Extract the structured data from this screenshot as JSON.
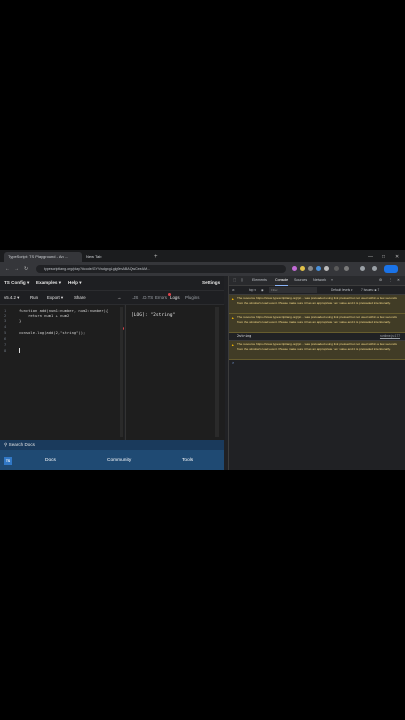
{
  "browser": {
    "tabs": [
      {
        "label": "TypeScript: TS Playground - An ..."
      },
      {
        "label": "New Tab"
      }
    ],
    "url": "typescriptlang.org/play?#code/GYVwdgxgLglg9mABAQwCeeAM...",
    "window_controls": [
      "—",
      "□",
      "✕"
    ]
  },
  "playground": {
    "menu": [
      {
        "label": "TS Config ▾"
      },
      {
        "label": "Examples ▾"
      },
      {
        "label": "Help ▾"
      },
      {
        "label": "Settings"
      }
    ],
    "toolbar": {
      "version": "v5.4.2 ▾",
      "run": "Run",
      "export": "Export ▾",
      "share": "Share",
      "arrow": "→"
    },
    "output_tabs": [
      {
        "label": ".JS"
      },
      {
        "label": ".D.TS"
      },
      {
        "label": "Errors"
      },
      {
        "label": "Logs"
      },
      {
        "label": "Plugins"
      }
    ],
    "code_lines": [
      {
        "n": "1",
        "text": "function add(num1:number, num2:number){"
      },
      {
        "n": "2",
        "text": "    return num1 + num2"
      },
      {
        "n": "3",
        "text": "}"
      },
      {
        "n": "4",
        "text": ""
      },
      {
        "n": "5",
        "text": "console.log(add(2,\"string\"));"
      },
      {
        "n": "6",
        "text": ""
      },
      {
        "n": "7",
        "text": ""
      },
      {
        "n": "8",
        "text": ""
      }
    ],
    "log_output": "[LOG]: \"2string\"",
    "search_docs": "Search Docs",
    "bottom_nav": [
      {
        "label": "Docs"
      },
      {
        "label": "Community"
      },
      {
        "label": "Tools"
      }
    ],
    "logo": "TS"
  },
  "devtools": {
    "tabs": [
      {
        "label": "Elements"
      },
      {
        "label": "Console"
      },
      {
        "label": "Sources"
      },
      {
        "label": "Network"
      },
      {
        "label": "»"
      }
    ],
    "filter": {
      "context": "top ▾",
      "placeholder": "Filter",
      "levels": "Default levels ▾",
      "issues": "7 Issues: ■ 7"
    },
    "messages": [
      {
        "type": "warning",
        "text": "The resource https://www.typescriptlang.org/js/... was preloaded using link preload but not used within a few seconds from the window's load event. Please make sure it has an appropriate `as` value and it is preloaded intentionally."
      },
      {
        "type": "warning",
        "text": "The resource https://www.typescriptlang.org/js/... was preloaded using link preload but not used within a few seconds from the window's load event. Please make sure it has an appropriate `as` value and it is preloaded intentionally."
      },
      {
        "type": "log",
        "text": "2string",
        "source": "runtime.js:177"
      },
      {
        "type": "warning",
        "text": "The resource https://www.typescriptlang.org/js/... was preloaded using link preload but not used within a few seconds from the window's load event. Please make sure it has an appropriate `as` value and it is preloaded intentionally."
      }
    ],
    "prompt": ">"
  },
  "colors": {
    "accent": "#3178c6",
    "docs_bar": "#1f4a73",
    "warning_bg": "#413c26",
    "error_marker": "#e0444c"
  }
}
